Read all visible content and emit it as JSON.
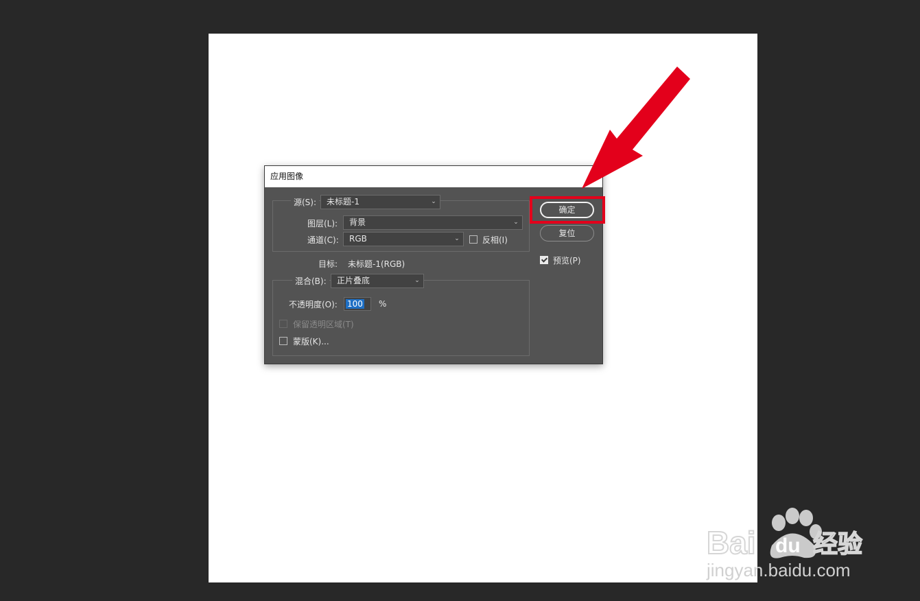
{
  "dialog": {
    "title": "应用图像",
    "source": {
      "label": "源(S):",
      "value": "未标题-1"
    },
    "layer": {
      "label": "图层(L):",
      "value": "背景"
    },
    "channel": {
      "label": "通道(C):",
      "value": "RGB"
    },
    "invert": {
      "label": "反相(I)",
      "checked": false
    },
    "target": {
      "label": "目标:",
      "value": "未标题-1(RGB)"
    },
    "blending": {
      "label": "混合(B):",
      "value": "正片叠底"
    },
    "opacity": {
      "label": "不透明度(O):",
      "value": "100",
      "unit": "%"
    },
    "preserve_transparency": {
      "label": "保留透明区域(T)",
      "checked": false,
      "disabled": true
    },
    "mask": {
      "label": "蒙版(K)...",
      "checked": false
    },
    "ok_button": "确定",
    "reset_button": "复位",
    "preview": {
      "label": "预览(P)",
      "checked": true
    }
  },
  "colors": {
    "workspace": "#282828",
    "canvas": "#ffffff",
    "dialog_bg": "#535353",
    "annotation_red": "#e3001b"
  },
  "watermark": {
    "brand": "Bai du 经验",
    "url": "jingyan.baidu.com"
  }
}
